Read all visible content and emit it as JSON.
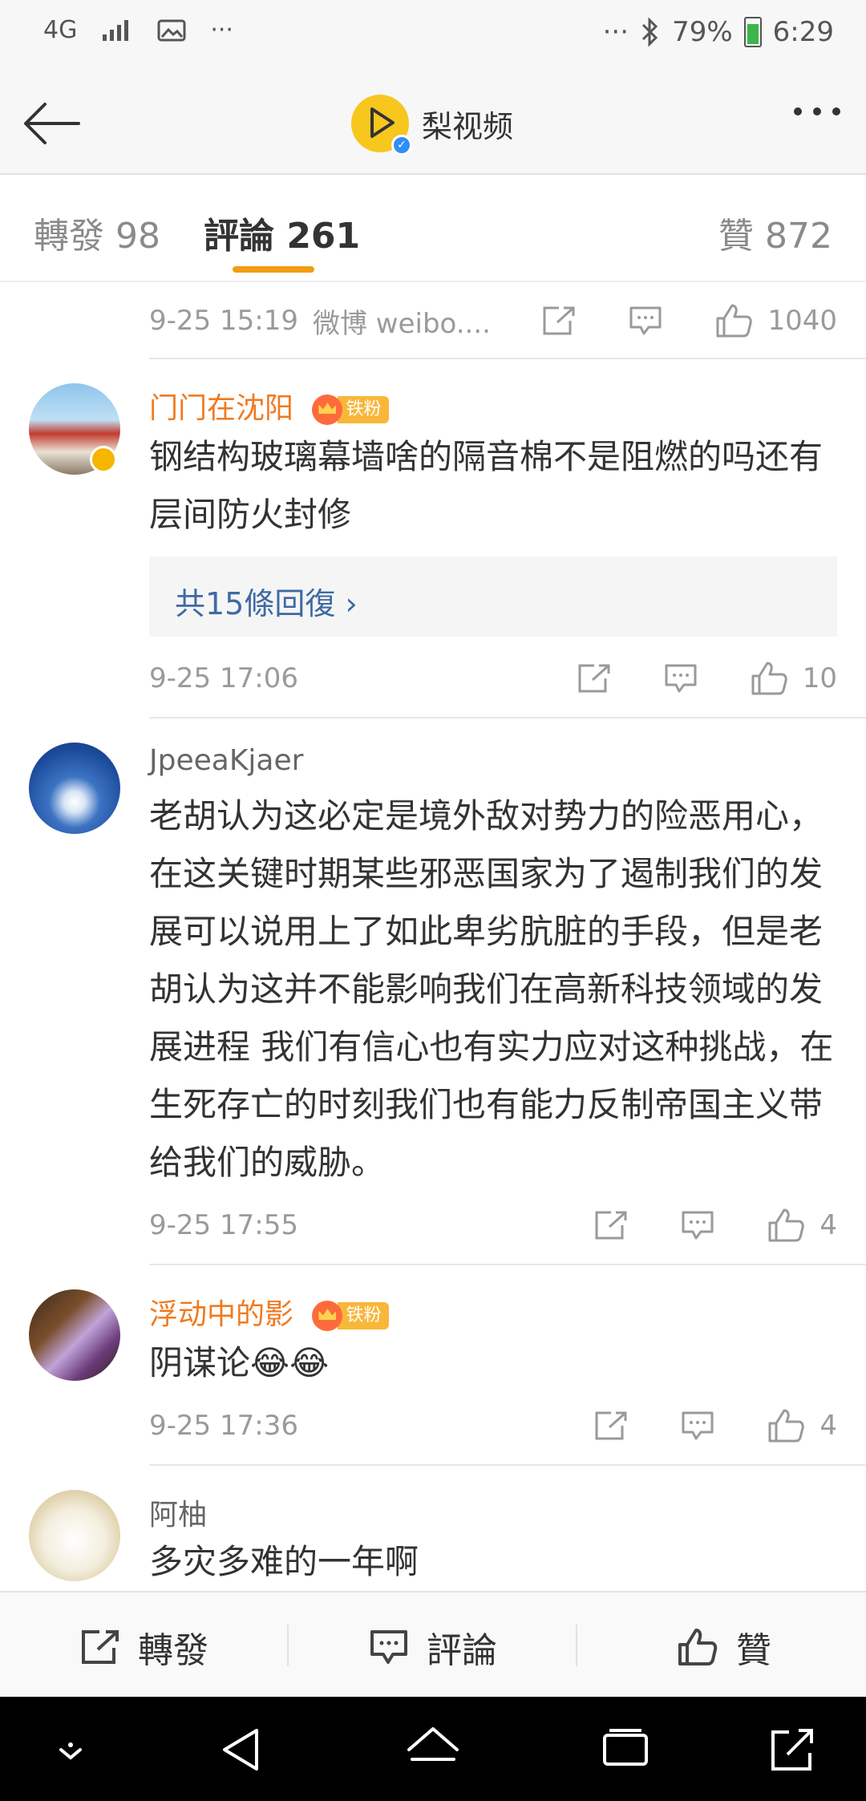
{
  "status_bar": {
    "network": "4G",
    "more_left": "···",
    "more_right": "···",
    "battery": "79%",
    "time": "6:29"
  },
  "header": {
    "channel_name": "梨视频"
  },
  "tabs": [
    {
      "label": "轉發 98"
    },
    {
      "label": "評論 261"
    },
    {
      "label": "贊 872"
    }
  ],
  "top_meta": {
    "time": "9-25 15:19",
    "source": "微博 weibo....",
    "likes": "1040"
  },
  "comments": [
    {
      "username": "门门在沈阳",
      "badge": "铁粉",
      "text": "钢结构玻璃幕墙啥的隔音棉不是阻燃的吗还有层间防火封修",
      "reply_link": "共15條回復",
      "time": "9-25 17:06",
      "likes": "10"
    },
    {
      "username": "JpeeaKjaer",
      "text": "老胡认为这必定是境外敌对势力的险恶用心，在这关键时期某些邪恶国家为了遏制我们的发展可以说用上了如此卑劣肮脏的手段，但是老胡认为这并不能影响我们在高新科技领域的发展进程 我们有信心也有实力应对这种挑战，在生死存亡的时刻我们也有能力反制帝国主义带给我们的威胁。",
      "time": "9-25 17:55",
      "likes": "4"
    },
    {
      "username": "浮动中的影",
      "badge": "铁粉",
      "text": "阴谋论😂😂",
      "time": "9-25 17:36",
      "likes": "4"
    },
    {
      "username": "阿柚",
      "text": "多灾多难的一年啊"
    }
  ],
  "bottom_bar": {
    "repost": "轉發",
    "comment": "評論",
    "like": "贊"
  },
  "colors": {
    "accent": "#f19e13",
    "username_orange": "#f07a1f",
    "link_blue": "#3e6aa3"
  }
}
